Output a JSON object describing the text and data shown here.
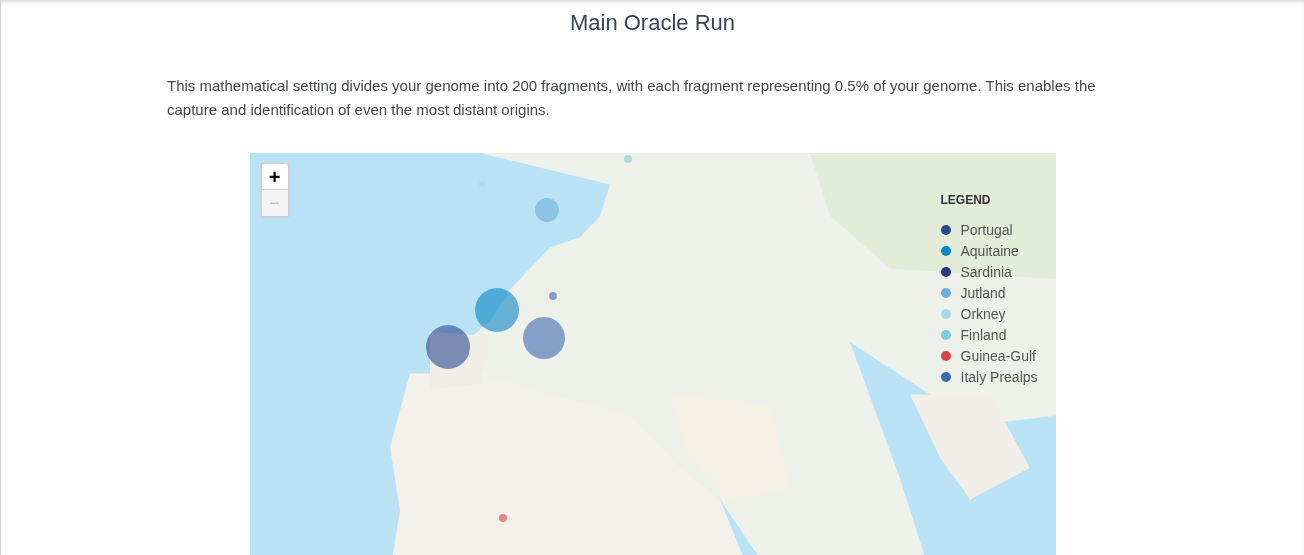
{
  "title": "Main Oracle Run",
  "description": "This mathematical setting divides your genome into 200 fragments, with each fragment representing 0.5% of your genome. This enables the capture and identification of even the most distant origins.",
  "map": {
    "zoom_in": "+",
    "zoom_out": "−",
    "legend": {
      "title": "LEGEND",
      "items": [
        {
          "label": "Portugal",
          "color": "#2b4a8c"
        },
        {
          "label": "Aquitaine",
          "color": "#0a86c4"
        },
        {
          "label": "Sardinia",
          "color": "#263a7e"
        },
        {
          "label": "Jutland",
          "color": "#6fb0dc"
        },
        {
          "label": "Orkney",
          "color": "#a9d8e8"
        },
        {
          "label": "Finland",
          "color": "#7fcbd6"
        },
        {
          "label": "Guinea-Gulf",
          "color": "#d9414a"
        },
        {
          "label": "Italy Prealps",
          "color": "#3d6aad"
        }
      ]
    }
  }
}
